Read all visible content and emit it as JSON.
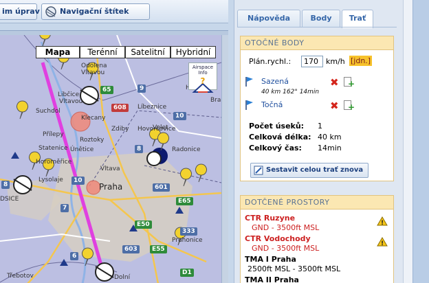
{
  "toolbar": {
    "edit_label": "im úprav",
    "tag_label": "Navigační štítek"
  },
  "map": {
    "types": [
      "Mapa",
      "Terénní",
      "Satelitní",
      "Hybridní"
    ],
    "selected_type": "Mapa",
    "airspace_info_label": "Airspace Info",
    "places": [
      "Odolena",
      "Vltavou",
      "Libčice",
      "Vltavou",
      "Klecany",
      "Líbeznice",
      "Husinec",
      "Hovorčovice",
      "Bra",
      "Suchdol",
      "Zdiby",
      "Roztoky",
      "Velet",
      "Přílepy",
      "Statenice",
      "Únětice",
      "Radonice",
      "Horoměřice",
      "Vltava",
      "Lysolaje",
      "Praha",
      "Dolní",
      "Třebotov",
      "Pruhonice",
      "DSICE"
    ],
    "shields": [
      "65",
      "9",
      "8",
      "10",
      "8",
      "10",
      "608",
      "7",
      "601",
      "E65",
      "E50",
      "333",
      "603",
      "E55",
      "6",
      "D1"
    ]
  },
  "tabs": [
    "Nápověda",
    "Body",
    "Trať"
  ],
  "active_tab": "Trať",
  "route": {
    "heading": "OTOČNÉ BODY",
    "speed_label": "Plán.rychl.:",
    "speed_value": "170",
    "speed_unit": "km/h",
    "units_link": "[jdn.]",
    "waypoints": [
      {
        "name": "Sazená",
        "info": "40 km 162° 14min"
      },
      {
        "name": "Točná",
        "info": ""
      }
    ],
    "stats": [
      {
        "label": "Počet úseků:",
        "value": "1"
      },
      {
        "label": "Celková délka:",
        "value": "40 km"
      },
      {
        "label": "Celkový čas:",
        "value": "14min"
      }
    ],
    "rebuild_label": "Sestavit celou trať znova"
  },
  "areas": {
    "heading": "DOTČENÉ PROSTORY",
    "items": [
      {
        "name": "CTR Ruzyne",
        "range": "GND - 3500ft MSL",
        "warning": true,
        "color": "#cc1f1f"
      },
      {
        "name": "CTR Vodochody",
        "range": "GND - 3500ft MSL",
        "warning": true,
        "color": "#cc1f1f"
      },
      {
        "name": "TMA I Praha",
        "range": "2500ft MSL - 3500ft MSL",
        "warning": false,
        "color": "#000000"
      },
      {
        "name": "TMA II Praha",
        "range": "",
        "warning": false,
        "color": "#000000"
      }
    ]
  },
  "colors": {
    "route_line": "#e040e0",
    "tma_fill": "#a8aee0",
    "accent": "#3566a8"
  }
}
